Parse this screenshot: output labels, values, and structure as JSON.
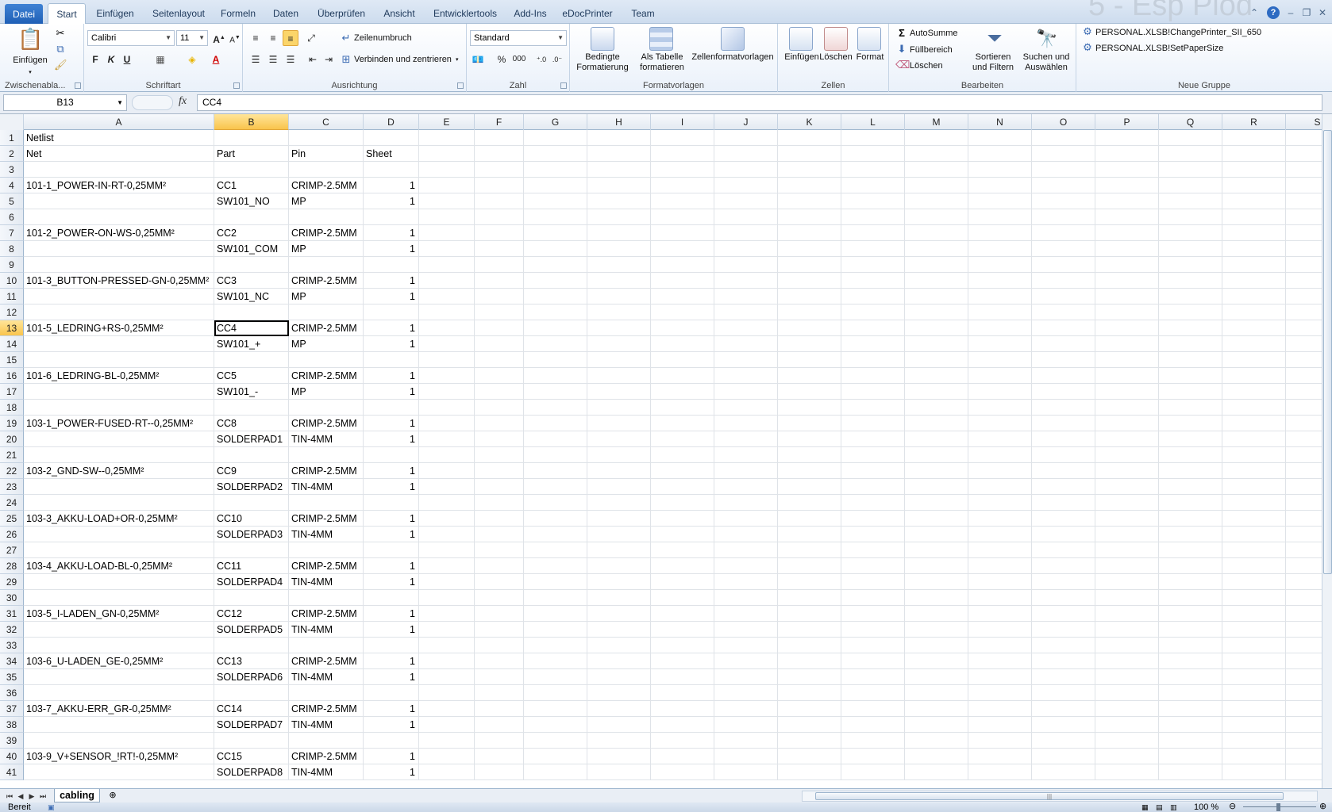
{
  "tabs": [
    "Datei",
    "Start",
    "Einfügen",
    "Seitenlayout",
    "Formeln",
    "Daten",
    "Überprüfen",
    "Ansicht",
    "Entwicklertools",
    "Add-Ins",
    "eDocPrinter",
    "Team"
  ],
  "window_title": "5 - Esp Plod",
  "ribbon": {
    "clipboard": {
      "paste": "Einfügen",
      "label": "Zwischenabla..."
    },
    "font": {
      "name": "Calibri",
      "size": "11",
      "bold": "F",
      "italic": "K",
      "underline": "U",
      "label": "Schriftart"
    },
    "alignment": {
      "wrap": "Zeilenumbruch",
      "merge": "Verbinden und zentrieren",
      "label": "Ausrichtung"
    },
    "number": {
      "format": "Standard",
      "percent": "%",
      "thousands": "000",
      "label": "Zahl"
    },
    "styles": {
      "conditional": "Bedingte\nFormatierung",
      "as_table": "Als Tabelle\nformatieren",
      "cell_styles": "Zellenformatvorlagen",
      "label": "Formatvorlagen"
    },
    "cells": {
      "insert": "Einfügen",
      "delete": "Löschen",
      "format": "Format",
      "label": "Zellen"
    },
    "editing": {
      "autosum": "AutoSumme",
      "fill": "Füllbereich",
      "clear": "Löschen",
      "sort": "Sortieren\nund Filtern",
      "find": "Suchen und\nAuswählen",
      "label": "Bearbeiten"
    },
    "custom": {
      "macro1": "PERSONAL.XLSB!ChangePrinter_SII_650",
      "macro2": "PERSONAL.XLSB!SetPaperSize",
      "label": "Neue Gruppe"
    }
  },
  "formula_bar": {
    "name_box": "B13",
    "fx": "fx",
    "content": "CC4"
  },
  "columns": [
    "A",
    "B",
    "C",
    "D",
    "E",
    "F",
    "G",
    "H",
    "I",
    "J",
    "K",
    "L",
    "M",
    "N",
    "O",
    "P",
    "Q",
    "R",
    "S"
  ],
  "selected_column": "B",
  "selected_row": 13,
  "rows": [
    {
      "n": 1,
      "a": "Netlist",
      "b": "",
      "c": "",
      "d": ""
    },
    {
      "n": 2,
      "a": "Net",
      "b": "Part",
      "c": "Pin",
      "d": "Sheet",
      "d_text": true
    },
    {
      "n": 3,
      "a": "",
      "b": "",
      "c": "",
      "d": ""
    },
    {
      "n": 4,
      "a": "101-1_POWER-IN-RT-0,25MM²",
      "b": "CC1",
      "c": "CRIMP-2.5MM",
      "d": "1"
    },
    {
      "n": 5,
      "a": "",
      "b": "SW101_NO",
      "c": "MP",
      "d": "1"
    },
    {
      "n": 6,
      "a": "",
      "b": "",
      "c": "",
      "d": ""
    },
    {
      "n": 7,
      "a": "101-2_POWER-ON-WS-0,25MM²",
      "b": "CC2",
      "c": "CRIMP-2.5MM",
      "d": "1"
    },
    {
      "n": 8,
      "a": "",
      "b": "SW101_COM",
      "c": "MP",
      "d": "1"
    },
    {
      "n": 9,
      "a": "",
      "b": "",
      "c": "",
      "d": ""
    },
    {
      "n": 10,
      "a": "101-3_BUTTON-PRESSED-GN-0,25MM²",
      "b": "CC3",
      "c": "CRIMP-2.5MM",
      "d": "1"
    },
    {
      "n": 11,
      "a": "",
      "b": "SW101_NC",
      "c": "MP",
      "d": "1"
    },
    {
      "n": 12,
      "a": "",
      "b": "",
      "c": "",
      "d": ""
    },
    {
      "n": 13,
      "a": "101-5_LEDRING+RS-0,25MM²",
      "b": "CC4",
      "c": "CRIMP-2.5MM",
      "d": "1"
    },
    {
      "n": 14,
      "a": "",
      "b": "SW101_+",
      "c": "MP",
      "d": "1"
    },
    {
      "n": 15,
      "a": "",
      "b": "",
      "c": "",
      "d": ""
    },
    {
      "n": 16,
      "a": "101-6_LEDRING-BL-0,25MM²",
      "b": "CC5",
      "c": "CRIMP-2.5MM",
      "d": "1"
    },
    {
      "n": 17,
      "a": "",
      "b": "SW101_-",
      "c": "MP",
      "d": "1"
    },
    {
      "n": 18,
      "a": "",
      "b": "",
      "c": "",
      "d": ""
    },
    {
      "n": 19,
      "a": "103-1_POWER-FUSED-RT--0,25MM²",
      "b": "CC8",
      "c": "CRIMP-2.5MM",
      "d": "1"
    },
    {
      "n": 20,
      "a": "",
      "b": "SOLDERPAD1",
      "c": "TIN-4MM",
      "d": "1"
    },
    {
      "n": 21,
      "a": "",
      "b": "",
      "c": "",
      "d": ""
    },
    {
      "n": 22,
      "a": "103-2_GND-SW--0,25MM²",
      "b": "CC9",
      "c": "CRIMP-2.5MM",
      "d": "1"
    },
    {
      "n": 23,
      "a": "",
      "b": "SOLDERPAD2",
      "c": "TIN-4MM",
      "d": "1"
    },
    {
      "n": 24,
      "a": "",
      "b": "",
      "c": "",
      "d": ""
    },
    {
      "n": 25,
      "a": "103-3_AKKU-LOAD+OR-0,25MM²",
      "b": "CC10",
      "c": "CRIMP-2.5MM",
      "d": "1"
    },
    {
      "n": 26,
      "a": "",
      "b": "SOLDERPAD3",
      "c": "TIN-4MM",
      "d": "1"
    },
    {
      "n": 27,
      "a": "",
      "b": "",
      "c": "",
      "d": ""
    },
    {
      "n": 28,
      "a": "103-4_AKKU-LOAD-BL-0,25MM²",
      "b": "CC11",
      "c": "CRIMP-2.5MM",
      "d": "1"
    },
    {
      "n": 29,
      "a": "",
      "b": "SOLDERPAD4",
      "c": "TIN-4MM",
      "d": "1"
    },
    {
      "n": 30,
      "a": "",
      "b": "",
      "c": "",
      "d": ""
    },
    {
      "n": 31,
      "a": "103-5_I-LADEN_GN-0,25MM²",
      "b": "CC12",
      "c": "CRIMP-2.5MM",
      "d": "1"
    },
    {
      "n": 32,
      "a": "",
      "b": "SOLDERPAD5",
      "c": "TIN-4MM",
      "d": "1"
    },
    {
      "n": 33,
      "a": "",
      "b": "",
      "c": "",
      "d": ""
    },
    {
      "n": 34,
      "a": "103-6_U-LADEN_GE-0,25MM²",
      "b": "CC13",
      "c": "CRIMP-2.5MM",
      "d": "1"
    },
    {
      "n": 35,
      "a": "",
      "b": "SOLDERPAD6",
      "c": "TIN-4MM",
      "d": "1"
    },
    {
      "n": 36,
      "a": "",
      "b": "",
      "c": "",
      "d": ""
    },
    {
      "n": 37,
      "a": "103-7_AKKU-ERR_GR-0,25MM²",
      "b": "CC14",
      "c": "CRIMP-2.5MM",
      "d": "1"
    },
    {
      "n": 38,
      "a": "",
      "b": "SOLDERPAD7",
      "c": "TIN-4MM",
      "d": "1"
    },
    {
      "n": 39,
      "a": "",
      "b": "",
      "c": "",
      "d": ""
    },
    {
      "n": 40,
      "a": "103-9_V+SENSOR_!RT!-0,25MM²",
      "b": "CC15",
      "c": "CRIMP-2.5MM",
      "d": "1"
    },
    {
      "n": 41,
      "a": "",
      "b": "SOLDERPAD8",
      "c": "TIN-4MM",
      "d": "1"
    }
  ],
  "sheet_tab": "cabling",
  "status": {
    "ready": "Bereit",
    "zoom": "100 %"
  }
}
